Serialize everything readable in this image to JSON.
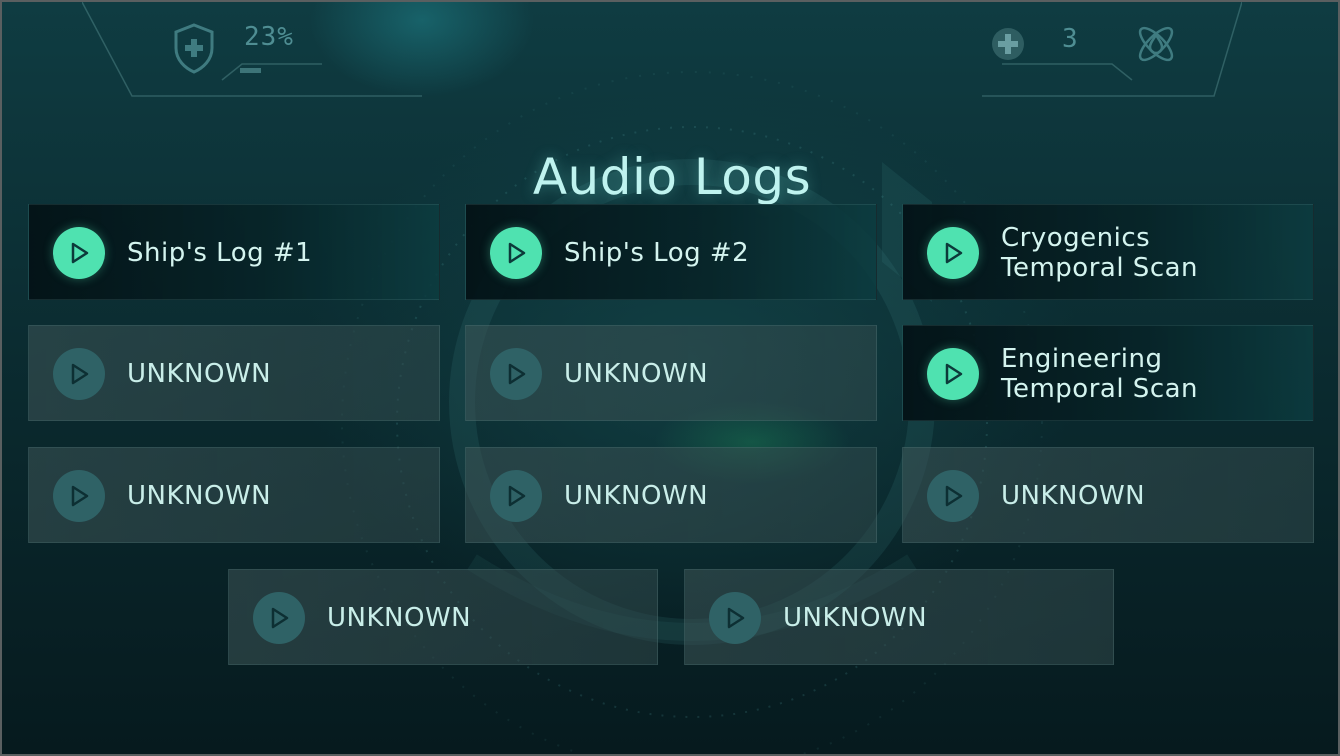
{
  "hud": {
    "left": {
      "icon": "shield-medical-icon",
      "value": "23%",
      "bar_fraction": 0.23
    },
    "right": {
      "icon_a": "plus-circle-icon",
      "value": "3",
      "icon_b": "atom-drop-icon"
    }
  },
  "title": "Audio Logs",
  "logs": [
    {
      "label": "Ship's Log #1",
      "state": "unlocked"
    },
    {
      "label": "Ship's Log #2",
      "state": "unlocked"
    },
    {
      "label": "Cryogenics\nTemporal Scan",
      "state": "unlocked"
    },
    {
      "label": "UNKNOWN",
      "state": "locked"
    },
    {
      "label": "UNKNOWN",
      "state": "locked"
    },
    {
      "label": "Engineering\nTemporal Scan",
      "state": "unlocked"
    },
    {
      "label": "UNKNOWN",
      "state": "locked"
    },
    {
      "label": "UNKNOWN",
      "state": "locked"
    },
    {
      "label": "UNKNOWN",
      "state": "locked"
    },
    {
      "label": "UNKNOWN",
      "state": "locked"
    },
    {
      "label": "UNKNOWN",
      "state": "locked"
    }
  ],
  "colors": {
    "accent": "#4fe2b0",
    "locked_play": "#2f6266",
    "title": "#bff3ef",
    "hud_dim": "#4f8e93"
  },
  "icons": {
    "play": "play-icon"
  }
}
